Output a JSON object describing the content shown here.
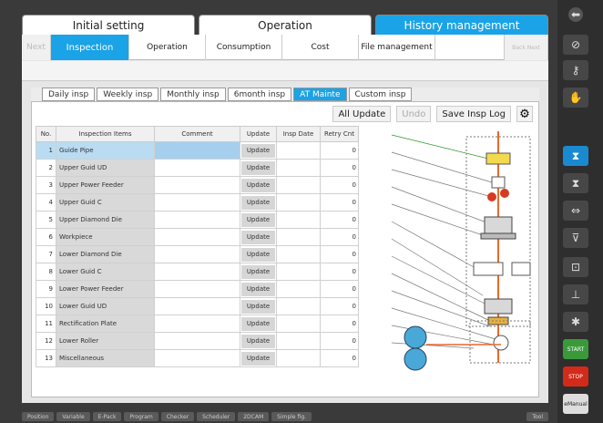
{
  "top_tabs": [
    "Initial setting",
    "Operation",
    "History management"
  ],
  "sub_tabs": [
    {
      "label": "Next",
      "state": "faded"
    },
    {
      "label": "Inspection",
      "state": "active"
    },
    {
      "label": "Operation",
      "state": "normal"
    },
    {
      "label": "Consumption",
      "state": "normal"
    },
    {
      "label": "Cost",
      "state": "normal"
    },
    {
      "label": "File management",
      "state": "normal"
    },
    {
      "label": "",
      "state": "normal"
    },
    {
      "label": "Back Next",
      "state": "faded"
    }
  ],
  "insp_tabs": [
    "Daily insp",
    "Weekly insp",
    "Monthly insp",
    "6month insp",
    "AT Mainte",
    "Custom insp"
  ],
  "actions": {
    "all_update": "All Update",
    "undo": "Undo",
    "save_log": "Save Insp Log",
    "settings_icon": "gear-icon"
  },
  "table": {
    "headers": [
      "No.",
      "Inspection Items",
      "Comment",
      "Update",
      "Insp Date",
      "Retry Cnt"
    ],
    "rows": [
      {
        "no": "1",
        "item": "Guide Pipe",
        "update": "Update",
        "cnt": "0"
      },
      {
        "no": "2",
        "item": "Upper Guid UD",
        "update": "Update",
        "cnt": "0"
      },
      {
        "no": "3",
        "item": "Upper Power Feeder",
        "update": "Update",
        "cnt": "0"
      },
      {
        "no": "4",
        "item": "Upper Guid C",
        "update": "Update",
        "cnt": "0"
      },
      {
        "no": "5",
        "item": "Upper Diamond Die",
        "update": "Update",
        "cnt": "0"
      },
      {
        "no": "6",
        "item": "Workpiece",
        "update": "Update",
        "cnt": "0"
      },
      {
        "no": "7",
        "item": "Lower Diamond Die",
        "update": "Update",
        "cnt": "0"
      },
      {
        "no": "8",
        "item": "Lower Guid C",
        "update": "Update",
        "cnt": "0"
      },
      {
        "no": "9",
        "item": "Lower Power Feeder",
        "update": "Update",
        "cnt": "0"
      },
      {
        "no": "10",
        "item": "Lower Guid UD",
        "update": "Update",
        "cnt": "0"
      },
      {
        "no": "11",
        "item": "Rectification Plate",
        "update": "Update",
        "cnt": "0"
      },
      {
        "no": "12",
        "item": "Lower Roller",
        "update": "Update",
        "cnt": "0"
      },
      {
        "no": "13",
        "item": "Miscellaneous",
        "update": "Update",
        "cnt": "0"
      }
    ]
  },
  "bottom_bar": [
    "Position",
    "Variable",
    "E-Pack",
    "Program",
    "Checker",
    "Scheduler",
    "2DCAM",
    "Simple fig.",
    "Tool"
  ],
  "right_panel": {
    "start": "START",
    "stop": "STOP",
    "ehn": "eManual"
  },
  "colors": {
    "accent": "#1aa3e6",
    "start": "#3a9a3a",
    "stop": "#d32a1a",
    "wire": "#e8692a"
  }
}
